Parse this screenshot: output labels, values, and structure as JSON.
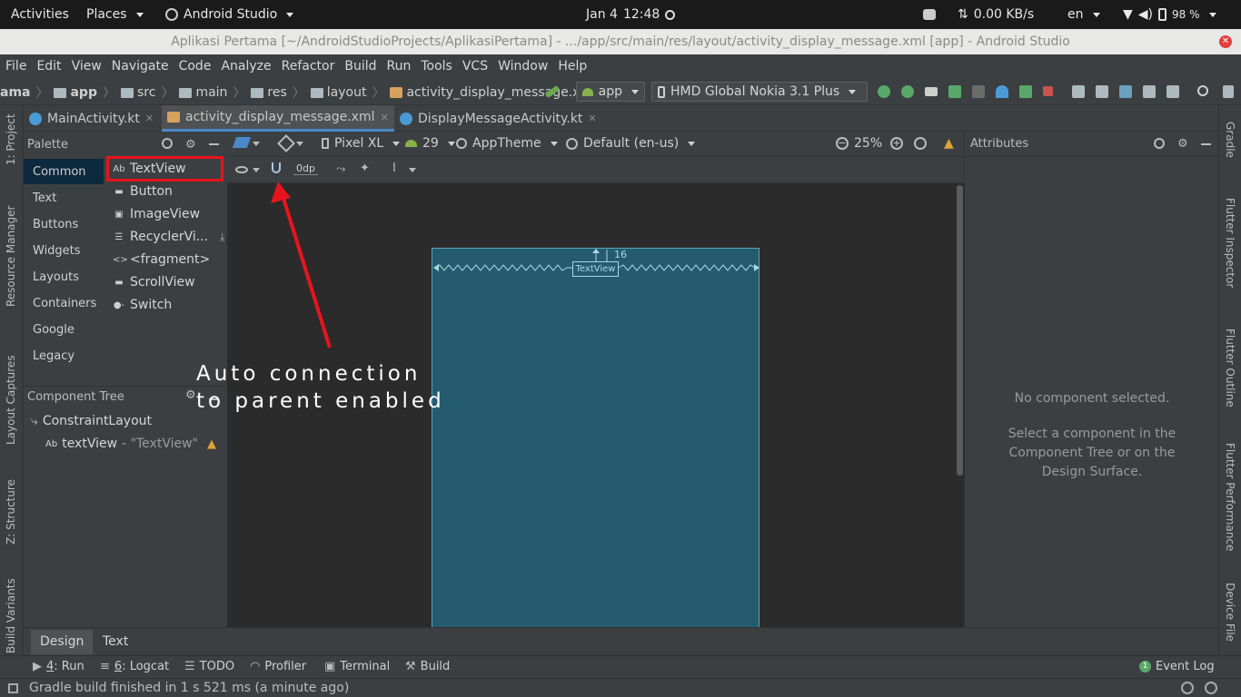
{
  "os_topbar": {
    "activities": "Activities",
    "places": "Places",
    "app_name": "Android Studio",
    "date": "Jan 4",
    "time": "12:48",
    "network_speed": "0.00 KB/s",
    "language": "en",
    "battery": "98 %"
  },
  "window": {
    "title": "Aplikasi Pertama [~/AndroidStudioProjects/AplikasiPertama] - .../app/src/main/res/layout/activity_display_message.xml [app] - Android Studio"
  },
  "menu": [
    "File",
    "Edit",
    "View",
    "Navigate",
    "Code",
    "Analyze",
    "Refactor",
    "Build",
    "Run",
    "Tools",
    "VCS",
    "Window",
    "Help"
  ],
  "breadcrumb": {
    "project": "ama",
    "items": [
      "app",
      "src",
      "main",
      "res",
      "layout",
      "activity_display_message.xml"
    ]
  },
  "run_config": "app",
  "device": "HMD Global Nokia 3.1 Plus",
  "left_stripe": [
    "1: Project",
    "Resource Manager",
    "Layout Captures",
    "Z: Structure",
    "Build Variants"
  ],
  "right_stripe": [
    "Gradle",
    "Flutter Inspector",
    "Flutter Outline",
    "Flutter Performance",
    "Device File"
  ],
  "editor_tabs": [
    {
      "label": "MainActivity.kt",
      "active": false
    },
    {
      "label": "activity_display_message.xml",
      "active": true
    },
    {
      "label": "DisplayMessageActivity.kt",
      "active": false
    }
  ],
  "palette": {
    "title": "Palette",
    "categories": [
      "Common",
      "Text",
      "Buttons",
      "Widgets",
      "Layouts",
      "Containers",
      "Google",
      "Legacy"
    ],
    "items": [
      {
        "label": "TextView",
        "glyph": "Ab"
      },
      {
        "label": "Button",
        "glyph": "▬"
      },
      {
        "label": "ImageView",
        "glyph": "▣"
      },
      {
        "label": "RecyclerVi...",
        "glyph": "☰"
      },
      {
        "label": "<fragment>",
        "glyph": "<>"
      },
      {
        "label": "ScrollView",
        "glyph": "▬"
      },
      {
        "label": "Switch",
        "glyph": "●-"
      }
    ]
  },
  "component_tree": {
    "title": "Component Tree",
    "root": "ConstraintLayout",
    "child_glyph": "Ab",
    "child": "textView",
    "child_text": "- \"TextView\""
  },
  "design_toolbar": {
    "device": "Pixel XL",
    "api": "29",
    "theme": "AppTheme",
    "locale": "Default (en-us)",
    "zoom": "25%",
    "margin": "0dp"
  },
  "canvas": {
    "textview_label": "TextView",
    "margin_value": "16"
  },
  "attributes": {
    "title": "Attributes",
    "empty_title": "No component selected.",
    "empty_hint": "Select a component in the Component Tree or on the Design Surface."
  },
  "design_tabs": [
    "Design",
    "Text"
  ],
  "tool_windows": [
    {
      "num": "4",
      "label": ": Run"
    },
    {
      "num": "6",
      "label": ": Logcat"
    },
    {
      "num": "",
      "label": "TODO"
    },
    {
      "num": "",
      "label": "Profiler"
    },
    {
      "num": "",
      "label": "Terminal"
    },
    {
      "num": "",
      "label": "Build"
    }
  ],
  "event_log": {
    "count": "1",
    "label": "Event Log"
  },
  "status": "Gradle build finished in 1 s 521 ms (a minute ago)",
  "annotation": "Auto connection\nto parent enabled",
  "colors": {
    "accent": "#4a88c7",
    "highlight": "#e8141c",
    "device": "#245b6e"
  }
}
